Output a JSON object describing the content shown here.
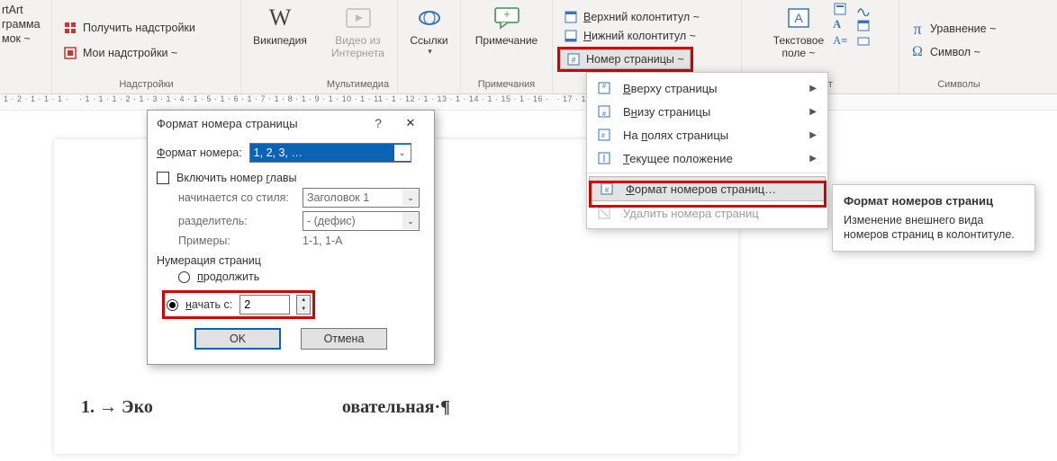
{
  "ribbon": {
    "group_smartart": {
      "label1": "rtArt",
      "label2": "грамма",
      "label3": "мок ~"
    },
    "group_addins": {
      "btn1": "Получить надстройки",
      "btn2": "Мои надстройки ~",
      "label": "Надстройки"
    },
    "group_wiki": {
      "btn": "Википедия"
    },
    "group_media": {
      "btn": "Видео из\nИнтернета",
      "label": "Мультимедиа"
    },
    "group_links": {
      "btn": "Ссылки"
    },
    "group_comments": {
      "btn": "Примечание",
      "label": "Примечания"
    },
    "group_hf": {
      "header": "Верхний колонтитул ~",
      "footer": "Нижний колонтитул ~",
      "pagenum": "Номер страницы ~"
    },
    "group_text": {
      "btn": "Текстовое\nполе ~",
      "label": "Текст"
    },
    "group_symbols": {
      "eq": "Уравнение ~",
      "sym": "Символ ~",
      "label": "Символы"
    }
  },
  "ruler": "1 · 2 · 1 · 1 · 1 ·    · 1 · 1 · 1 · 2 · 1 · 3 · 1 · 4 · 1 · 5 · 1 · 6 · 1 · 7 · 1 · 8 · 1 · 9 · 1 · 10 · 1 · 11 · 1 · 12 · 1 · 13 · 1 · 14 · 1 · 15 · 1 · 16 ·   · 17 · 1 · 18 ·",
  "doc_line": "1. → Эко                                          овательная·¶",
  "dropdown": {
    "top": "Вверху страницы",
    "bottom": "Внизу страницы",
    "margins": "На полях страницы",
    "current": "Текущее положение",
    "format": "Формат номеров страниц…",
    "remove": "Удалить номера страниц"
  },
  "tooltip": {
    "title": "Формат номеров страниц",
    "desc": "Изменение внешнего вида номеров страниц в колонтитуле."
  },
  "dlg": {
    "title": "Формат номера страницы",
    "format_label": "Формат номера:",
    "format_value": "1, 2, 3, …",
    "include_chapter": "Включить номер главы",
    "starts_style_label": "начинается со стиля:",
    "starts_style_value": "Заголовок 1",
    "separator_label": "разделитель:",
    "separator_value": "-   (дефис)",
    "examples_label": "Примеры:",
    "examples_value": "1-1, 1-A",
    "numbering_label": "Нумерация страниц",
    "continue": "продолжить",
    "start_at": "начать с:",
    "start_value": "2",
    "ok": "OK",
    "cancel": "Отмена"
  }
}
